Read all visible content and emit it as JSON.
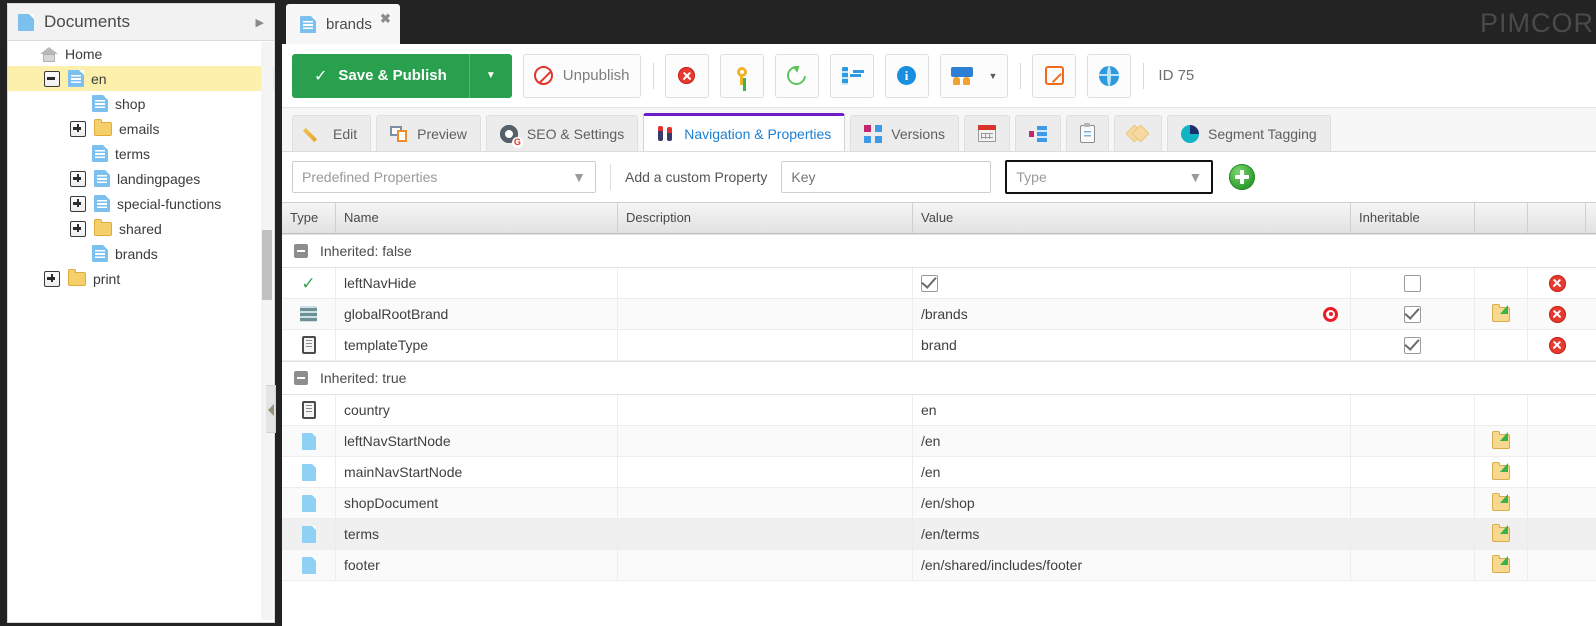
{
  "app": {
    "logo_text": "PIMCORE",
    "document_tab": {
      "label": "brands",
      "close": "✖",
      "icon": "document-icon"
    }
  },
  "left_panel": {
    "title": "Documents",
    "collapse_arrow": "▶",
    "tree": [
      {
        "label": "Home",
        "icon": "home-icon",
        "indent": 0,
        "expander": "none",
        "selected": false
      },
      {
        "label": "en",
        "icon": "document-icon",
        "indent": 1,
        "expander": "minus",
        "selected": true
      },
      {
        "label": "shop",
        "icon": "document-icon",
        "indent": 2,
        "expander": "none",
        "selected": false
      },
      {
        "label": "emails",
        "icon": "folder-icon",
        "indent": 2,
        "expander": "plus",
        "selected": false
      },
      {
        "label": "terms",
        "icon": "document-icon",
        "indent": 2,
        "expander": "none",
        "selected": false
      },
      {
        "label": "landingpages",
        "icon": "document-icon",
        "indent": 2,
        "expander": "plus",
        "selected": false
      },
      {
        "label": "special-functions",
        "icon": "document-icon",
        "indent": 2,
        "expander": "plus",
        "selected": false
      },
      {
        "label": "shared",
        "icon": "folder-icon",
        "indent": 2,
        "expander": "plus",
        "selected": false
      },
      {
        "label": "brands",
        "icon": "document-icon",
        "indent": 2,
        "expander": "none",
        "selected": false
      },
      {
        "label": "print",
        "icon": "folder-icon",
        "indent": 1,
        "expander": "plus",
        "selected": false
      }
    ]
  },
  "toolbar": {
    "save_publish_label": "Save & Publish",
    "save_check": "✓",
    "save_menu_caret": "▼",
    "unpublish_label": "Unpublish",
    "id_label": "ID 75",
    "buttons": [
      {
        "name": "delete-button",
        "icon": "delete-icon"
      },
      {
        "name": "permissions-button",
        "icon": "key-icon"
      },
      {
        "name": "reload-button",
        "icon": "refresh-icon"
      },
      {
        "name": "tree-jump-button",
        "icon": "tree-node-icon"
      },
      {
        "name": "info-button",
        "icon": "info-icon"
      },
      {
        "name": "translations-button",
        "icon": "users-icon",
        "caret": "▼"
      },
      {
        "name": "open-button",
        "icon": "external-link-icon"
      },
      {
        "name": "preview-button",
        "icon": "globe-edit-icon"
      }
    ]
  },
  "editor_tabs": [
    {
      "label": "Edit",
      "icon": "pencil-icon",
      "active": false
    },
    {
      "label": "Preview",
      "icon": "preview-icon",
      "active": false
    },
    {
      "label": "SEO & Settings",
      "icon": "gear-icon",
      "active": false
    },
    {
      "label": "Navigation & Properties",
      "icon": "navigation-icon",
      "active": true
    },
    {
      "label": "Versions",
      "icon": "versions-icon",
      "active": false
    },
    {
      "label": "",
      "icon": "calendar-icon",
      "active": false
    },
    {
      "label": "",
      "icon": "structure-icon",
      "active": false
    },
    {
      "label": "",
      "icon": "clipboard-icon",
      "active": false
    },
    {
      "label": "",
      "icon": "tag-icon",
      "active": false
    },
    {
      "label": "Segment Tagging",
      "icon": "pie-chart-icon",
      "active": false
    }
  ],
  "property_bar": {
    "predefined_label": "Predefined Properties",
    "predefined_caret": "▼",
    "add_custom_label": "Add a custom Property",
    "key_placeholder": "Key",
    "key_value": "",
    "type_label": "Type",
    "type_caret": "▼",
    "add_button": "add-property-button"
  },
  "grid": {
    "columns": [
      "Type",
      "Name",
      "Description",
      "Value",
      "Inheritable",
      "",
      ""
    ],
    "groups": [
      {
        "label": "Inherited: false",
        "rows": [
          {
            "type_icon": "check-icon",
            "name": "leftNavHide",
            "description": "",
            "value": "",
            "value_checkbox": true,
            "value_target": false,
            "inheritable": false,
            "has_open": false,
            "has_delete": true
          },
          {
            "type_icon": "database-icon",
            "name": "globalRootBrand",
            "description": "",
            "value": "/brands",
            "value_checkbox": null,
            "value_target": true,
            "inheritable": true,
            "has_open": true,
            "has_delete": true
          },
          {
            "type_icon": "text-icon",
            "name": "templateType",
            "description": "",
            "value": "brand",
            "value_checkbox": null,
            "value_target": false,
            "inheritable": true,
            "has_open": false,
            "has_delete": true
          }
        ]
      },
      {
        "label": "Inherited: true",
        "rows": [
          {
            "type_icon": "text-icon",
            "name": "country",
            "description": "",
            "value": "en",
            "value_checkbox": null,
            "value_target": false,
            "inheritable": null,
            "has_open": false,
            "has_delete": false
          },
          {
            "type_icon": "document-icon",
            "name": "leftNavStartNode",
            "description": "",
            "value": "/en",
            "value_checkbox": null,
            "value_target": false,
            "inheritable": null,
            "has_open": true,
            "has_delete": false
          },
          {
            "type_icon": "document-icon",
            "name": "mainNavStartNode",
            "description": "",
            "value": "/en",
            "value_checkbox": null,
            "value_target": false,
            "inheritable": null,
            "has_open": true,
            "has_delete": false
          },
          {
            "type_icon": "document-icon",
            "name": "shopDocument",
            "description": "",
            "value": "/en/shop",
            "value_checkbox": null,
            "value_target": false,
            "inheritable": null,
            "has_open": true,
            "has_delete": false
          },
          {
            "type_icon": "document-icon",
            "name": "terms",
            "description": "",
            "value": "/en/terms",
            "value_checkbox": null,
            "value_target": false,
            "inheritable": null,
            "has_open": true,
            "has_delete": false,
            "highlighted": true
          },
          {
            "type_icon": "document-icon",
            "name": "footer",
            "description": "",
            "value": "/en/shared/includes/footer",
            "value_checkbox": null,
            "value_target": false,
            "inheritable": null,
            "has_open": true,
            "has_delete": false
          }
        ]
      }
    ]
  }
}
